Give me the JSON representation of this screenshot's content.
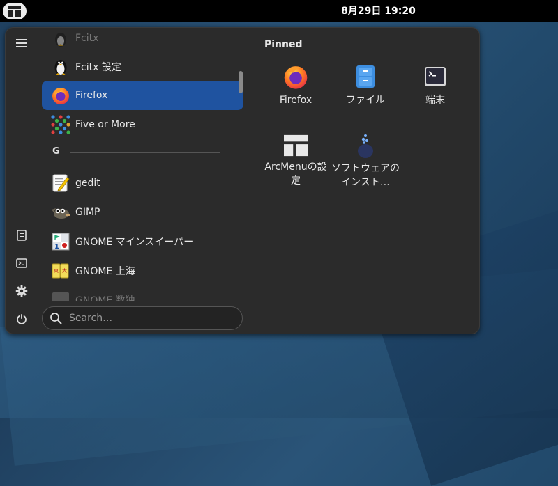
{
  "topbar": {
    "clock": "8月29日  19:20"
  },
  "applist": {
    "items": [
      {
        "label": "Fcitx",
        "icon": "fcitx-penguin-icon"
      },
      {
        "label": "Fcitx 設定",
        "icon": "fcitx-config-penguin-icon"
      },
      {
        "label": "Firefox",
        "icon": "firefox-icon"
      },
      {
        "label": "Five or More",
        "icon": "five-or-more-icon"
      },
      {
        "label": "gedit",
        "icon": "gedit-icon"
      },
      {
        "label": "GIMP",
        "icon": "gimp-icon"
      },
      {
        "label": "GNOME マインスイーパー",
        "icon": "mines-icon"
      },
      {
        "label": "GNOME 上海",
        "icon": "mahjongg-icon"
      },
      {
        "label": "GNOME 数独",
        "icon": "sudoku-icon"
      }
    ],
    "section_g": "G"
  },
  "search": {
    "placeholder": "Search…"
  },
  "pinned": {
    "title": "Pinned",
    "items": [
      {
        "label": "Firefox",
        "icon": "firefox-icon"
      },
      {
        "label": "ファイル",
        "icon": "files-icon"
      },
      {
        "label": "端末",
        "icon": "terminal-icon"
      },
      {
        "label": "ArcMenuの設定",
        "icon": "arcmenu-settings-icon"
      },
      {
        "label": "ソフトウェアのインスト…",
        "icon": "software-icon"
      }
    ]
  },
  "colors": {
    "accent": "#1f53a0",
    "menu_bg": "#2b2b2b",
    "topbar": "#000000"
  }
}
